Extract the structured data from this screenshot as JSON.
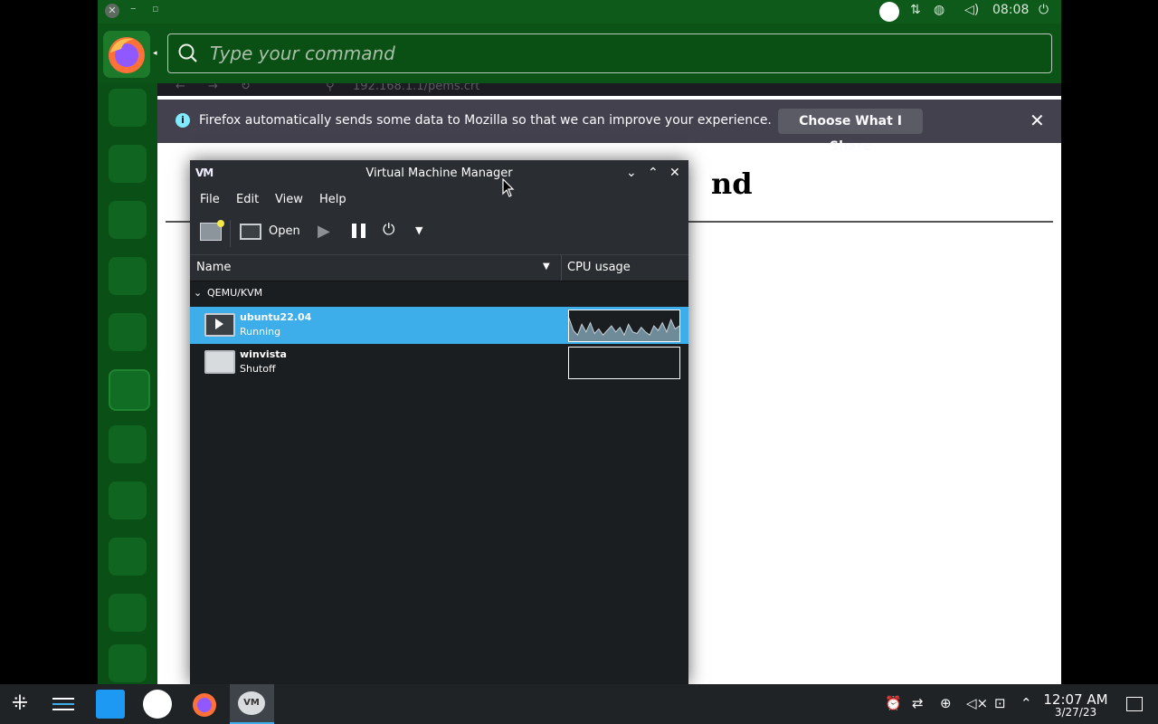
{
  "guest_topbar": {
    "close_glyph": "✕",
    "min_glyph": "–",
    "max_glyph": "▫",
    "clock": "08:08"
  },
  "command_bar": {
    "placeholder": "Type your command"
  },
  "firefox": {
    "url": "192.168.1.1/pems.crt",
    "notice_text": "Firefox automatically sends some data to Mozilla so that we can improve your experience.",
    "notice_button": "Choose What I Share",
    "page_heading_fragment": "nd"
  },
  "vmm": {
    "title": "Virtual Machine Manager",
    "logo": "VM",
    "menu": [
      "File",
      "Edit",
      "View",
      "Help"
    ],
    "toolbar_open": "Open",
    "col_name": "Name",
    "col_cpu": "CPU usage",
    "group": "QEMU/KVM",
    "vms": [
      {
        "name": "ubuntu22.04",
        "status": "Running"
      },
      {
        "name": "winvista",
        "status": "Shutoff"
      }
    ],
    "cpu_history": [
      0.75,
      0.35,
      0.2,
      0.55,
      0.3,
      0.6,
      0.25,
      0.4,
      0.2,
      0.35,
      0.5,
      0.3,
      0.45,
      0.2,
      0.55,
      0.3,
      0.25,
      0.45,
      0.3,
      0.2,
      0.5,
      0.35,
      0.6,
      0.3,
      0.7,
      0.4,
      0.5
    ]
  },
  "taskbar": {
    "time": "12:07 AM",
    "date": "3/27/23"
  },
  "colors": {
    "selection": "#3daee9",
    "guest_green": "#0a4a15"
  }
}
